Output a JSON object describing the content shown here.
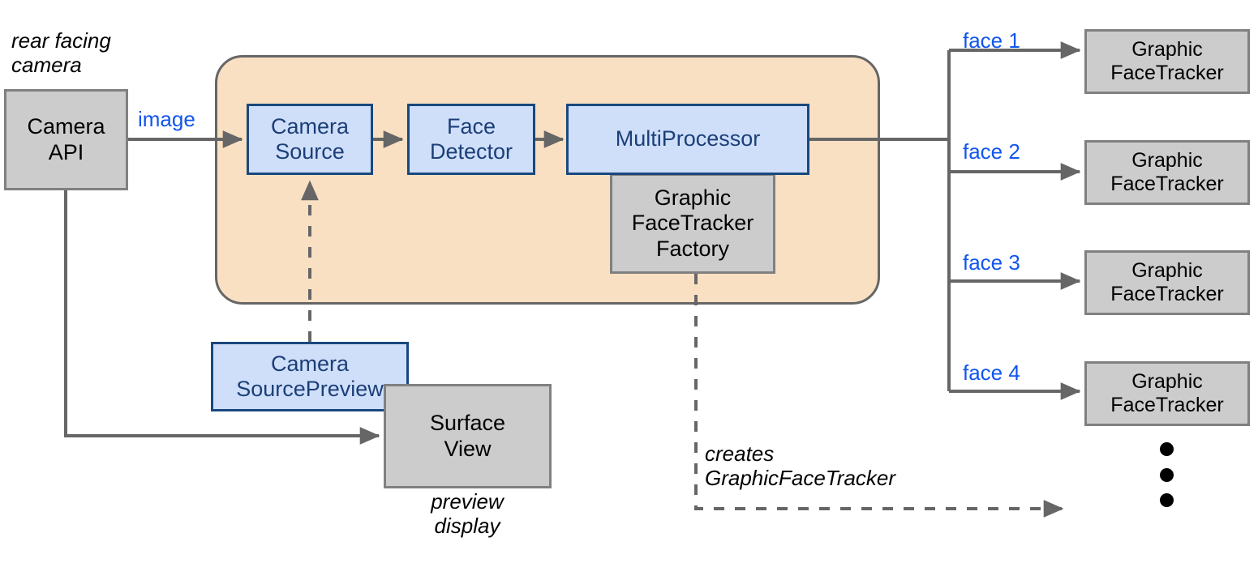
{
  "diagram": {
    "title": "Android Face Tracker architecture diagram",
    "colors": {
      "grey_fill": "#cccccc",
      "grey_stroke": "#808080",
      "blue_fill": "#cfdffa",
      "blue_stroke": "#19487e",
      "blue_text": "#1c3f78",
      "orange_fill": "#fae0c3",
      "orange_stroke": "#666666",
      "edge": "#666666",
      "link_label": "#1155ee"
    },
    "annotations": {
      "rear_facing_camera": "rear facing\ncamera",
      "preview_display": "preview\ndisplay",
      "creates_graphic_face_tracker": "creates\nGraphicFaceTracker"
    },
    "nodes": {
      "camera_api": "Camera\nAPI",
      "camera_source": "Camera\nSource",
      "face_detector": "Face\nDetector",
      "multi_processor": "MultiProcessor",
      "graphic_face_tracker_factory": "Graphic\nFaceTracker\nFactory",
      "camera_source_preview": "Camera\nSourcePreview",
      "surface_view": "Surface\nView"
    },
    "trackers": [
      {
        "label": "Graphic\nFaceTracker",
        "edge_label": "face 1"
      },
      {
        "label": "Graphic\nFaceTracker",
        "edge_label": "face 2"
      },
      {
        "label": "Graphic\nFaceTracker",
        "edge_label": "face 3"
      },
      {
        "label": "Graphic\nFaceTracker",
        "edge_label": "face 4"
      }
    ],
    "edges": {
      "image": "image"
    },
    "ellipsis_dots": 3
  }
}
